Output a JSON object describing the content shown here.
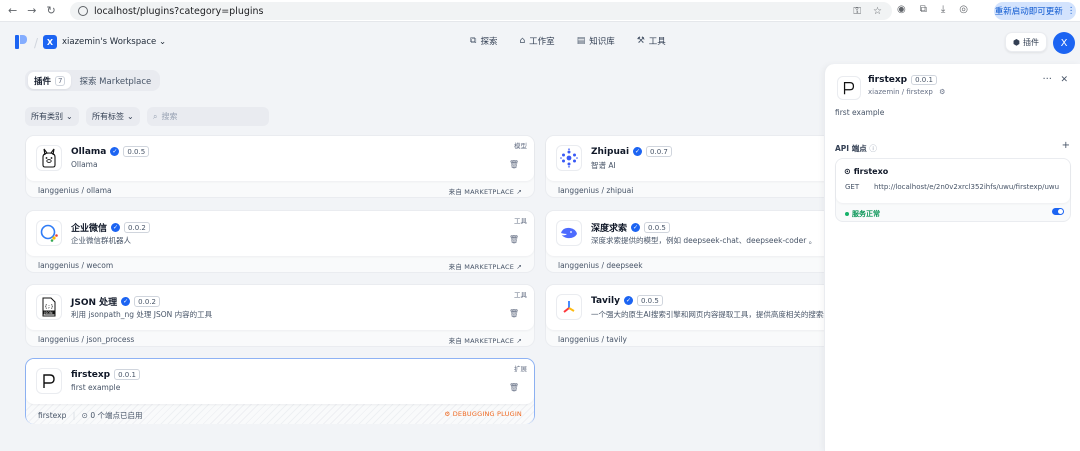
{
  "browser": {
    "url": "localhost/plugins?category=plugins",
    "update_button": "重新启动即可更新"
  },
  "header": {
    "workspace_initial": "X",
    "workspace_name": "xiazemin's Workspace",
    "nav": [
      {
        "label": "探索",
        "icon": "explore-icon"
      },
      {
        "label": "工作室",
        "icon": "studio-icon"
      },
      {
        "label": "知识库",
        "icon": "knowledge-icon"
      },
      {
        "label": "工具",
        "icon": "tools-icon"
      }
    ],
    "plugins_button": "插件",
    "user_initial": "X"
  },
  "tabs": [
    {
      "label": "插件",
      "count": "7"
    },
    {
      "label": "探索 Marketplace",
      "count": ""
    }
  ],
  "filters": {
    "category": "所有类别",
    "tags": "所有标签",
    "search_placeholder": "搜索"
  },
  "cards": [
    {
      "name": "Ollama",
      "version": "0.0.5",
      "desc": "Ollama",
      "category": "模型",
      "path": "langgenius / ollama",
      "source": "来自 MARKETPLACE ↗",
      "verified": true
    },
    {
      "name": "Zhipuai",
      "version": "0.0.7",
      "desc": "智谱 AI",
      "category": "",
      "path": "langgenius / zhipuai",
      "source": "",
      "verified": true
    },
    {
      "name": "企业微信",
      "version": "0.0.2",
      "desc": "企业微信群机器人",
      "category": "工具",
      "path": "langgenius / wecom",
      "source": "来自 MARKETPLACE ↗",
      "verified": true
    },
    {
      "name": "深度求索",
      "version": "0.0.5",
      "desc": "深度求索提供的模型，例如 deepseek-chat、deepseek-coder 。",
      "category": "",
      "path": "langgenius / deepseek",
      "source": "",
      "verified": true
    },
    {
      "name": "JSON 处理",
      "version": "0.0.2",
      "desc": "利用 jsonpath_ng 处理 JSON 内容的工具",
      "category": "工具",
      "path": "langgenius / json_process",
      "source": "来自 MARKETPLACE ↗",
      "verified": true
    },
    {
      "name": "Tavily",
      "version": "0.0.5",
      "desc": "一个强大的原生AI搜索引擎和网页内容提取工具，提供高度相关的搜索结",
      "category": "",
      "path": "langgenius / tavily",
      "source": "",
      "verified": true
    },
    {
      "name": "firstexp",
      "version": "0.0.1",
      "desc": "first example",
      "category": "扩展",
      "path": "firstexp",
      "endpoints": "0 个端点已启用",
      "source": "DEBUGGING PLUGIN",
      "verified": false
    }
  ],
  "panel": {
    "name": "firstexp",
    "version": "0.0.1",
    "author_path": "xiazemin / firstexp",
    "description": "first example",
    "api_heading": "API 端点",
    "endpoint": {
      "name": "firstexo",
      "method": "GET",
      "url": "http://localhost/e/2n0v2xrcl352ihfs/uwu/firstexp/uwu",
      "status": "服务正常",
      "enabled": true
    }
  },
  "colors": {
    "accent": "#1c64f2",
    "debug": "#ef6820",
    "ok": "#079455"
  }
}
